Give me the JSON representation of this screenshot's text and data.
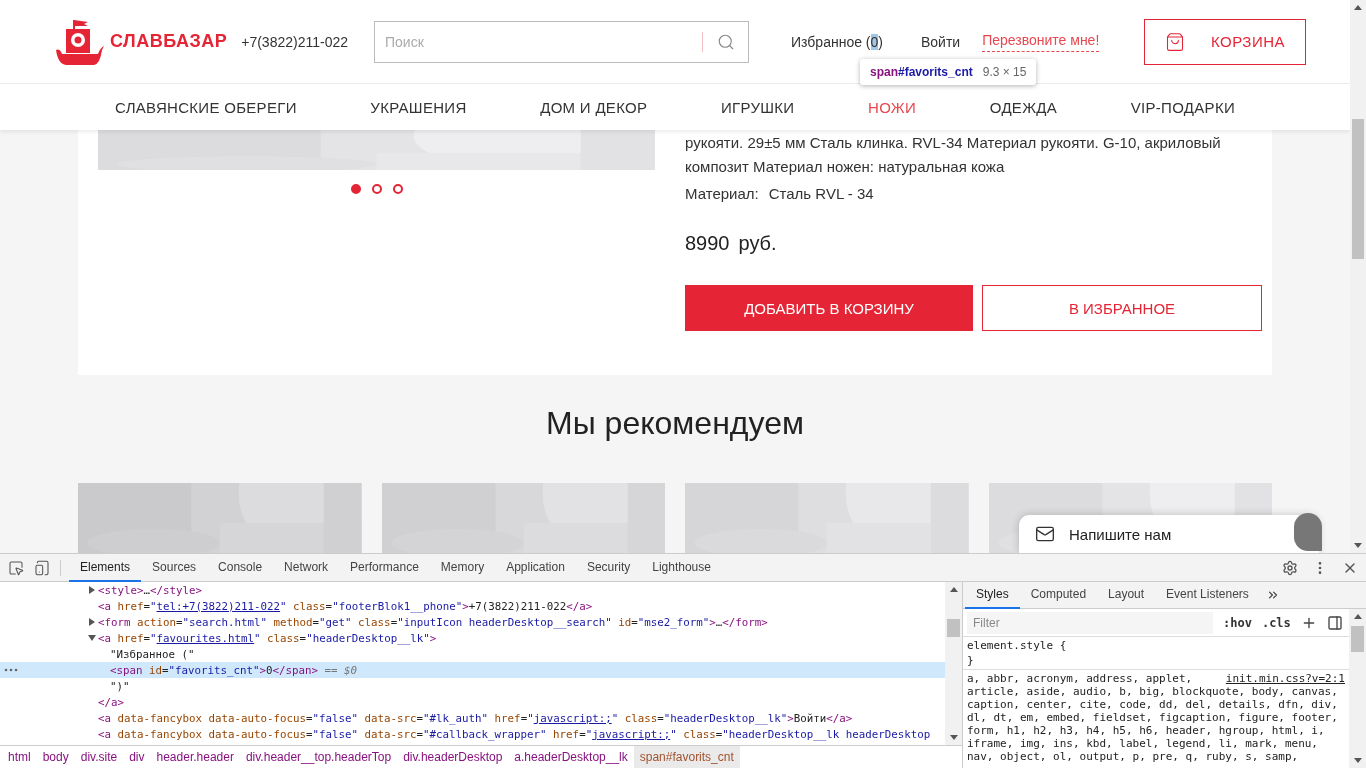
{
  "page": {
    "header": {
      "logo_text": "СЛАВБАЗАР",
      "phone": "+7(3822)211-022",
      "search": {
        "placeholder": "Поиск"
      },
      "favorites": {
        "label": "Избранное (",
        "count": "0",
        "close": ")",
        "count_inspected": true
      },
      "login": "Войти",
      "callback": "Перезвоните мне!",
      "cart": "КОРЗИНА"
    },
    "tooltip": {
      "tag": "span",
      "selector": "#favorits_cnt",
      "size": "9.3 × 15"
    },
    "nav": [
      {
        "label": "СЛАВЯНСКИЕ ОБЕРЕГИ",
        "selected": false
      },
      {
        "label": "УКРАШЕНИЯ",
        "selected": false
      },
      {
        "label": "ДОМ И ДЕКОР",
        "selected": false
      },
      {
        "label": "ИГРУШКИ",
        "selected": false
      },
      {
        "label": "НОЖИ",
        "selected": true
      },
      {
        "label": "ОДЕЖДА",
        "selected": false
      },
      {
        "label": "VIP-ПОДАРКИ",
        "selected": false
      }
    ],
    "product": {
      "image": {
        "kind": "picture"
      },
      "dots": [
        {
          "selected": true
        },
        {
          "selected": false
        },
        {
          "selected": false
        }
      ],
      "description": [
        "рукояти. 29±5 мм Сталь клинка. RVL-34 Материал рукояти. G-10, акриловый",
        "композит Материал ножен: натуральная кожа"
      ],
      "material_label": "Материал:",
      "material_value": "Сталь RVL - 34",
      "price": "8990",
      "currency": "руб.",
      "add_to_cart": "ДОБАВИТЬ В КОРЗИНУ",
      "add_to_favorites": "В ИЗБРАННОЕ"
    },
    "recommend": {
      "title": "Мы рекомендуем",
      "cards": [
        {
          "kind": "picture"
        },
        {
          "kind": "picture"
        },
        {
          "kind": "picture"
        },
        {
          "kind": "picture"
        }
      ]
    },
    "chat": {
      "label": "Напишите нам"
    }
  },
  "devtools": {
    "tabs": [
      {
        "label": "Elements",
        "selected": true
      },
      {
        "label": "Sources",
        "selected": false
      },
      {
        "label": "Console",
        "selected": false
      },
      {
        "label": "Network",
        "selected": false
      },
      {
        "label": "Performance",
        "selected": false
      },
      {
        "label": "Memory",
        "selected": false
      },
      {
        "label": "Application",
        "selected": false
      },
      {
        "label": "Security",
        "selected": false
      },
      {
        "label": "Lighthouse",
        "selected": false
      }
    ],
    "code_lines": [
      {
        "kind": "collapsed",
        "selected": false,
        "tokens": [
          {
            "kind": "tag",
            "text": "<style>"
          },
          {
            "kind": "text",
            "text": "…"
          },
          {
            "kind": "tag",
            "text": "</style>"
          }
        ]
      },
      {
        "kind": "leaf",
        "selected": false,
        "tokens": [
          {
            "kind": "tag",
            "text": "<a"
          },
          {
            "kind": "attr",
            "text": " href"
          },
          {
            "kind": "text",
            "text": "="
          },
          {
            "kind": "value",
            "text": "\""
          },
          {
            "kind": "link",
            "text": "tel:+7(3822)211-022"
          },
          {
            "kind": "value",
            "text": "\""
          },
          {
            "kind": "attr",
            "text": " class"
          },
          {
            "kind": "text",
            "text": "="
          },
          {
            "kind": "value",
            "text": "\"footerBlok1__phone\""
          },
          {
            "kind": "tag",
            "text": ">"
          },
          {
            "kind": "text",
            "text": "+7(3822)211-022"
          },
          {
            "kind": "tag",
            "text": "</a>"
          }
        ]
      },
      {
        "kind": "collapsed",
        "selected": false,
        "tokens": [
          {
            "kind": "tag",
            "text": "<form"
          },
          {
            "kind": "attr",
            "text": " action"
          },
          {
            "kind": "text",
            "text": "="
          },
          {
            "kind": "value",
            "text": "\"search.html\""
          },
          {
            "kind": "attr",
            "text": " method"
          },
          {
            "kind": "text",
            "text": "="
          },
          {
            "kind": "value",
            "text": "\"get\""
          },
          {
            "kind": "attr",
            "text": " class"
          },
          {
            "kind": "text",
            "text": "="
          },
          {
            "kind": "value",
            "text": "\"inputIcon headerDesktop__search\""
          },
          {
            "kind": "attr",
            "text": " id"
          },
          {
            "kind": "text",
            "text": "="
          },
          {
            "kind": "value",
            "text": "\"mse2_form\""
          },
          {
            "kind": "tag",
            "text": ">"
          },
          {
            "kind": "text",
            "text": "…"
          },
          {
            "kind": "tag",
            "text": "</form>"
          }
        ]
      },
      {
        "kind": "expanded",
        "selected": false,
        "tokens": [
          {
            "kind": "tag",
            "text": "<a"
          },
          {
            "kind": "attr",
            "text": " href"
          },
          {
            "kind": "text",
            "text": "="
          },
          {
            "kind": "value",
            "text": "\""
          },
          {
            "kind": "link",
            "text": "favourites.html"
          },
          {
            "kind": "value",
            "text": "\""
          },
          {
            "kind": "attr",
            "text": " class"
          },
          {
            "kind": "text",
            "text": "="
          },
          {
            "kind": "value",
            "text": "\"headerDesktop__lk\""
          },
          {
            "kind": "tag",
            "text": ">"
          }
        ],
        "children": [
          {
            "selected": false,
            "tokens": [
              {
                "kind": "text",
                "text": "\"Избранное (\""
              }
            ]
          },
          {
            "selected": true,
            "tokens": [
              {
                "kind": "tag",
                "text": "<span"
              },
              {
                "kind": "attr",
                "text": " id"
              },
              {
                "kind": "text",
                "text": "="
              },
              {
                "kind": "value",
                "text": "\"favorits_cnt\""
              },
              {
                "kind": "tag",
                "text": ">"
              },
              {
                "kind": "text",
                "text": "0"
              },
              {
                "kind": "tag",
                "text": "</span>"
              },
              {
                "kind": "hint",
                "text": " == $0"
              }
            ]
          },
          {
            "selected": false,
            "tokens": [
              {
                "kind": "text",
                "text": "\")\""
              }
            ]
          }
        ],
        "closing": [
          {
            "kind": "tag",
            "text": "</a>"
          }
        ]
      },
      {
        "kind": "leaf",
        "selected": false,
        "tokens": [
          {
            "kind": "tag",
            "text": "<a"
          },
          {
            "kind": "attr",
            "text": " data-fancybox data-auto-focus"
          },
          {
            "kind": "text",
            "text": "="
          },
          {
            "kind": "value",
            "text": "\"false\""
          },
          {
            "kind": "attr",
            "text": " data-src"
          },
          {
            "kind": "text",
            "text": "="
          },
          {
            "kind": "value",
            "text": "\"#lk_auth\""
          },
          {
            "kind": "attr",
            "text": " href"
          },
          {
            "kind": "text",
            "text": "="
          },
          {
            "kind": "value",
            "text": "\""
          },
          {
            "kind": "link",
            "text": "javascript:;"
          },
          {
            "kind": "value",
            "text": "\""
          },
          {
            "kind": "attr",
            "text": " class"
          },
          {
            "kind": "text",
            "text": "="
          },
          {
            "kind": "value",
            "text": "\"headerDesktop__lk\""
          },
          {
            "kind": "tag",
            "text": ">"
          },
          {
            "kind": "text",
            "text": "Войти"
          },
          {
            "kind": "tag",
            "text": "</a>"
          }
        ]
      },
      {
        "kind": "leaf",
        "selected": false,
        "tokens": [
          {
            "kind": "tag",
            "text": "<a"
          },
          {
            "kind": "attr",
            "text": " data-fancybox data-auto-focus"
          },
          {
            "kind": "text",
            "text": "="
          },
          {
            "kind": "value",
            "text": "\"false\""
          },
          {
            "kind": "attr",
            "text": " data-src"
          },
          {
            "kind": "text",
            "text": "="
          },
          {
            "kind": "value",
            "text": "\"#callback_wrapper\""
          },
          {
            "kind": "attr",
            "text": " href"
          },
          {
            "kind": "text",
            "text": "="
          },
          {
            "kind": "value",
            "text": "\""
          },
          {
            "kind": "link",
            "text": "javascript:;"
          },
          {
            "kind": "value",
            "text": "\""
          },
          {
            "kind": "attr",
            "text": " class"
          },
          {
            "kind": "text",
            "text": "="
          },
          {
            "kind": "value",
            "text": "\"headerDesktop__lk headerDesktop"
          }
        ]
      }
    ],
    "breadcrumbs": [
      {
        "label": "html",
        "selected": false
      },
      {
        "label": "body",
        "selected": false
      },
      {
        "label": "div.site",
        "selected": false
      },
      {
        "label": "div",
        "selected": false
      },
      {
        "label": "header.header",
        "selected": false
      },
      {
        "label": "div.header__top.headerTop",
        "selected": false
      },
      {
        "label": "div.headerDesktop",
        "selected": false
      },
      {
        "label": "a.headerDesktop__lk",
        "selected": false
      },
      {
        "label": "span#favorits_cnt",
        "selected": true
      }
    ],
    "styles_tabs": [
      {
        "label": "Styles",
        "selected": true
      },
      {
        "label": "Computed",
        "selected": false
      },
      {
        "label": "Layout",
        "selected": false
      },
      {
        "label": "Event Listeners",
        "selected": false
      }
    ],
    "filter": {
      "placeholder": "Filter"
    },
    "hov": ":hov",
    "cls": ".cls",
    "element_style": [
      "element.style {",
      "}"
    ],
    "rule": {
      "source": "init.min.css?v=2:1",
      "selector_lines": [
        "a, abbr, acronym, address, applet,",
        "article, aside, audio, b, big, blockquote, body, canvas,",
        "caption, center, cite, code, dd, del, details, dfn, div,",
        "dl, dt, em, embed, fieldset, figcaption, figure, footer,",
        "form, h1, h2, h3, h4, h5, h6, header, hgroup, html, i,",
        "iframe, img, ins, kbd, label, legend, li, mark, menu,",
        "nav, object, ol, output, p, pre, q, ruby, s, samp,"
      ]
    }
  }
}
